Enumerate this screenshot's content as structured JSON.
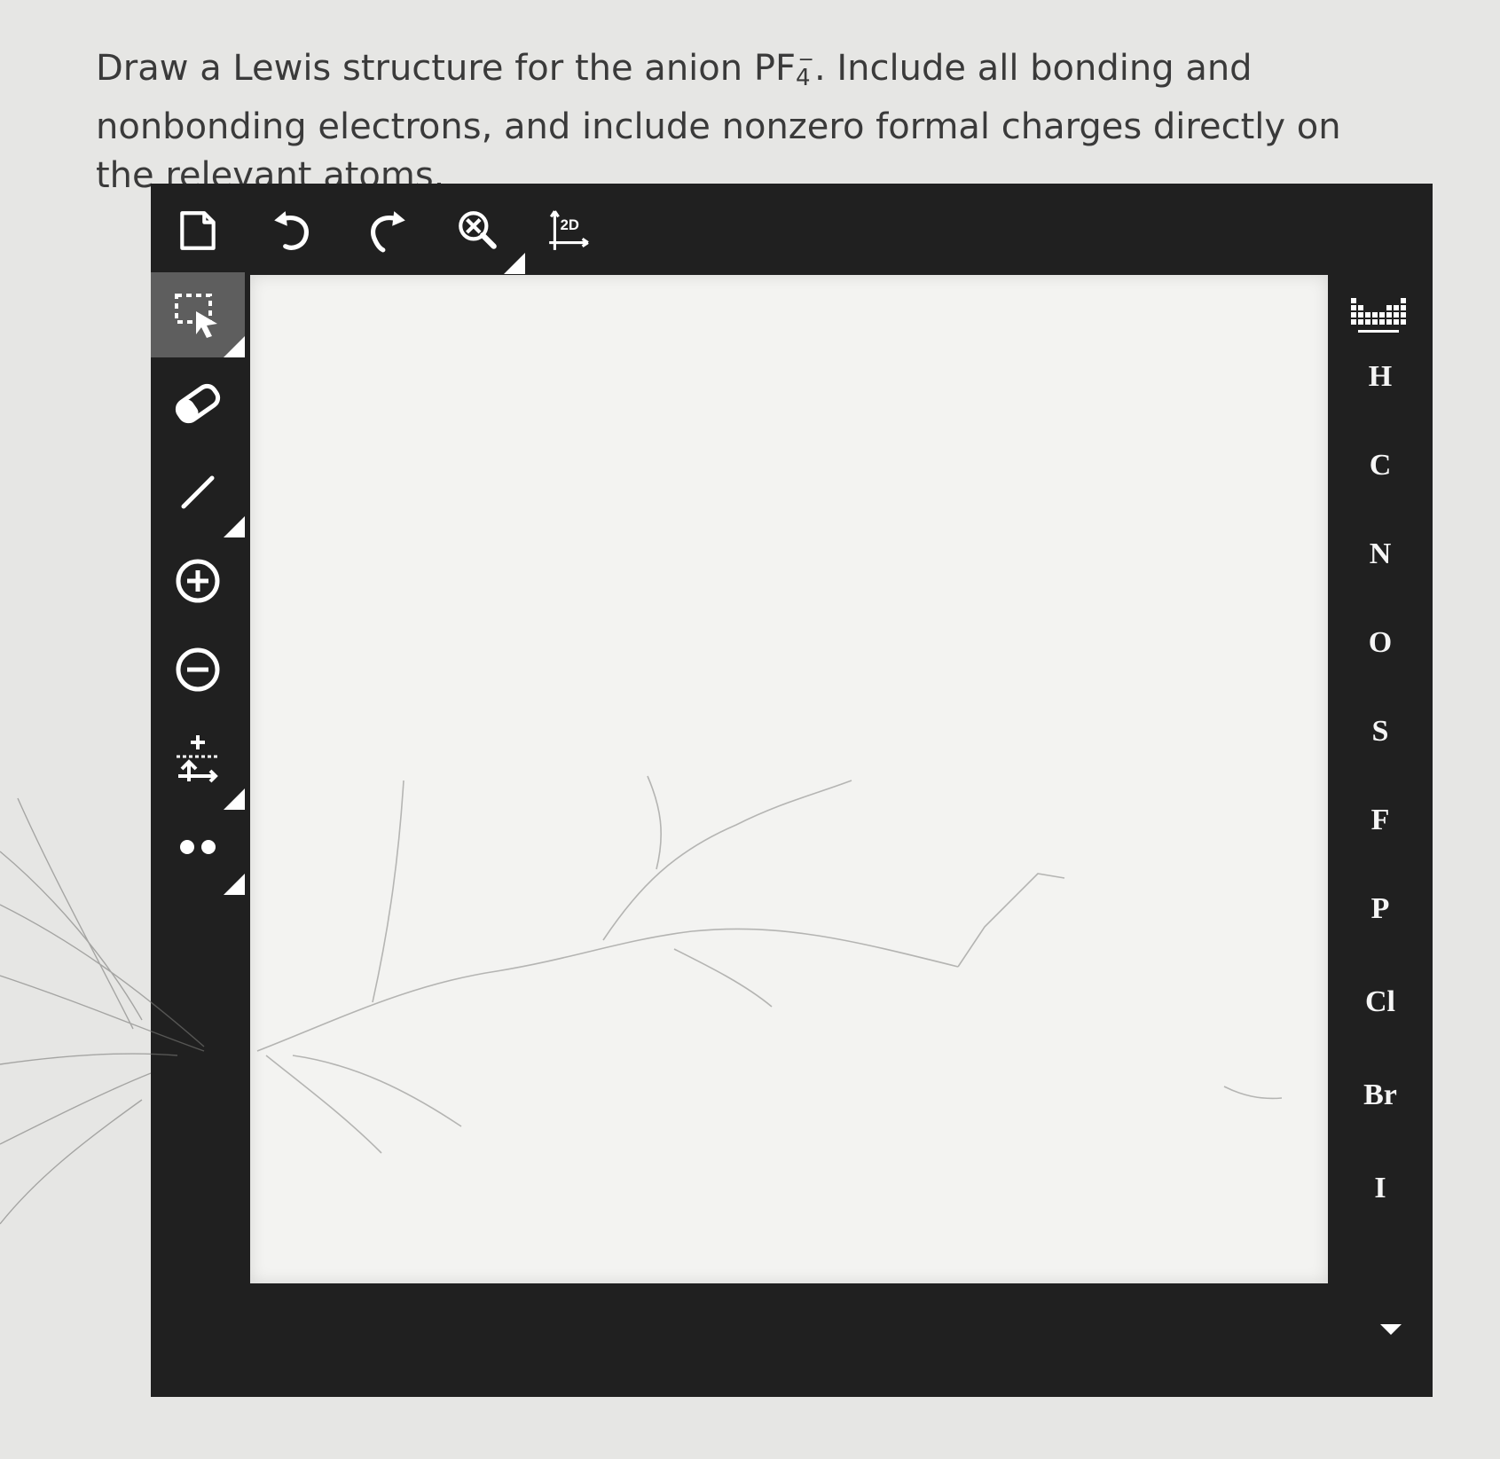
{
  "question": {
    "text_before": "Draw a Lewis structure for the anion PF",
    "subscript": "4",
    "superscript": "−",
    "text_after": ". Include all bonding and nonbonding electrons, and include nonzero formal charges directly on the relevant atoms."
  },
  "top_toolbar": {
    "icons": [
      "new-document-icon",
      "undo-icon",
      "redo-icon",
      "zoom-reset-icon",
      "2d-clean-icon"
    ],
    "clean_label": "2D"
  },
  "left_toolbar": {
    "icons": [
      "selection-icon",
      "eraser-icon",
      "bond-icon",
      "positive-charge-icon",
      "negative-charge-icon",
      "arrow-tool-icon",
      "lone-pair-icon"
    ]
  },
  "elements": [
    "H",
    "C",
    "N",
    "O",
    "S",
    "F",
    "P",
    "Cl",
    "Br",
    "I"
  ],
  "colors": {
    "toolbar": "#202020",
    "canvas": "#f3f3f1",
    "icon": "#ffffff",
    "active_tool": "#5e5e5e"
  }
}
